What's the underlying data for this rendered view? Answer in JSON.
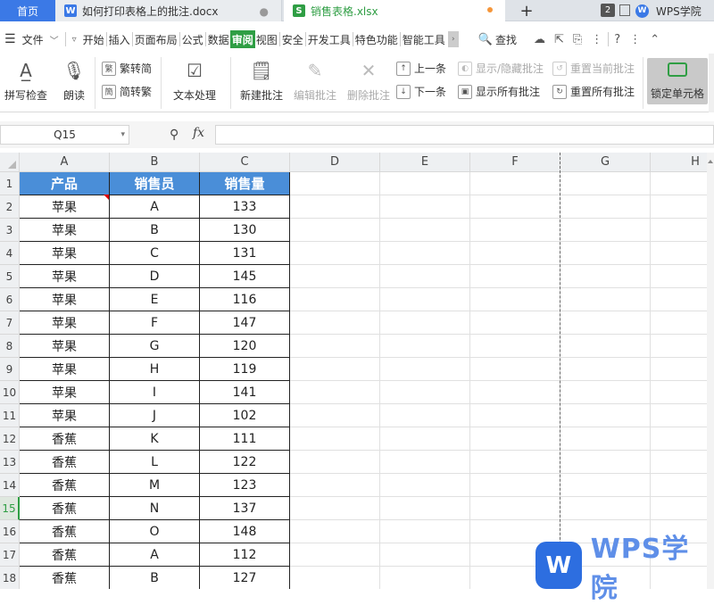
{
  "tabs": {
    "home": "首页",
    "doc": "如何打印表格上的批注.docx",
    "sheet": "销售表格.xlsx",
    "new_tab": "+",
    "window_count": "2",
    "account": "WPS学院"
  },
  "menu": {
    "file": "文件",
    "items": [
      "开始",
      "插入",
      "页面布局",
      "公式",
      "数据",
      "审阅",
      "视图",
      "安全",
      "开发工具",
      "特色功能",
      "智能工具"
    ],
    "active_index": 5,
    "search": "查找"
  },
  "ribbon": {
    "spellcheck": "拼写检查",
    "read_aloud": "朗读",
    "trad_to_simp": "繁转简",
    "simp_to_trad": "简转繁",
    "text_process": "文本处理",
    "new_comment": "新建批注",
    "edit_comment": "编辑批注",
    "delete_comment": "删除批注",
    "prev": "上一条",
    "next": "下一条",
    "show_hide_comment": "显示/隐藏批注",
    "show_all_comments": "显示所有批注",
    "reset_current_comment": "重置当前批注",
    "reset_all_comments": "重置所有批注",
    "lock_cell": "锁定单元格"
  },
  "formula_bar": {
    "name_box": "Q15",
    "fx": "fx",
    "value": ""
  },
  "sheet": {
    "columns": [
      "A",
      "B",
      "C",
      "D",
      "E",
      "F",
      "G",
      "H"
    ],
    "rows": [
      "1",
      "2",
      "3",
      "4",
      "5",
      "6",
      "7",
      "8",
      "9",
      "10",
      "11",
      "12",
      "13",
      "14",
      "15",
      "16",
      "17",
      "18"
    ],
    "selected_row": "15",
    "headers": [
      "产品",
      "销售员",
      "销售量"
    ],
    "data": [
      [
        "苹果",
        "A",
        "133"
      ],
      [
        "苹果",
        "B",
        "130"
      ],
      [
        "苹果",
        "C",
        "131"
      ],
      [
        "苹果",
        "D",
        "145"
      ],
      [
        "苹果",
        "E",
        "116"
      ],
      [
        "苹果",
        "F",
        "147"
      ],
      [
        "苹果",
        "G",
        "120"
      ],
      [
        "苹果",
        "H",
        "119"
      ],
      [
        "苹果",
        "I",
        "141"
      ],
      [
        "苹果",
        "J",
        "102"
      ],
      [
        "香蕉",
        "K",
        "111"
      ],
      [
        "香蕉",
        "L",
        "122"
      ],
      [
        "香蕉",
        "M",
        "123"
      ],
      [
        "香蕉",
        "N",
        "137"
      ],
      [
        "香蕉",
        "O",
        "148"
      ],
      [
        "香蕉",
        "A",
        "112"
      ],
      [
        "香蕉",
        "B",
        "127"
      ]
    ]
  },
  "watermark": {
    "logo": "W",
    "text": "WPS学院"
  }
}
